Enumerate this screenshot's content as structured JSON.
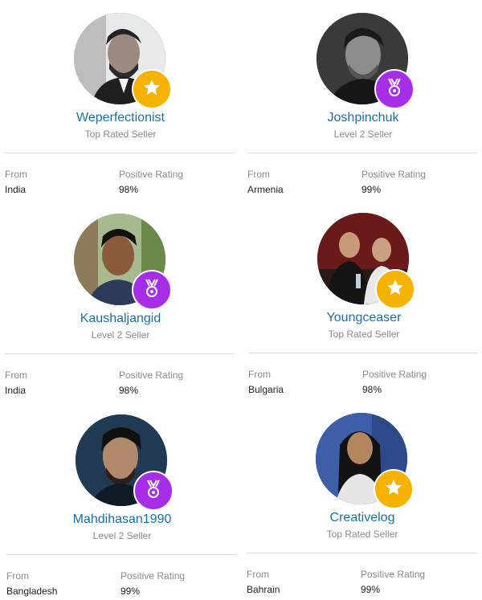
{
  "colors": {
    "name": "#1d6fa3",
    "muted": "#8a8a8a",
    "top_rated_badge": "#f5b300",
    "level2_badge": "#a72ee8",
    "divider": "#dddddd"
  },
  "labels": {
    "from": "From",
    "positive_rating": "Positive Rating"
  },
  "sellers": [
    {
      "name": "Weperfectionist",
      "level": "Top Rated Seller",
      "badge": "star-icon",
      "from": "India",
      "rating": "98%"
    },
    {
      "name": "Joshpinchuk",
      "level": "Level 2 Seller",
      "badge": "medal-icon",
      "from": "Armenia",
      "rating": "99%"
    },
    {
      "name": "Kaushaljangid",
      "level": "Level 2 Seller",
      "badge": "medal-icon",
      "from": "India",
      "rating": "98%"
    },
    {
      "name": "Youngceaser",
      "level": "Top Rated Seller",
      "badge": "star-icon",
      "from": "Bulgaria",
      "rating": "98%"
    },
    {
      "name": "Mahdihasan1990",
      "level": "Level 2 Seller",
      "badge": "medal-icon",
      "from": "Bangladesh",
      "rating": "99%"
    },
    {
      "name": "Creativelog",
      "level": "Top Rated Seller",
      "badge": "star-icon",
      "from": "Bahrain",
      "rating": "99%"
    }
  ]
}
